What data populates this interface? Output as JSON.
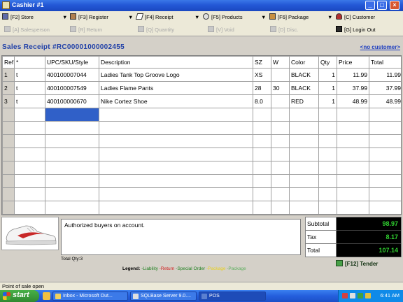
{
  "window": {
    "title": "Cashier #1",
    "controls": [
      "_",
      "□",
      "×"
    ]
  },
  "toolbar": {
    "row1": [
      {
        "label": "[F2] Store",
        "icon": "store-icon"
      },
      {
        "label": "[F3] Register",
        "icon": "register-icon"
      },
      {
        "label": "[F4] Receipt",
        "icon": "receipt-icon"
      },
      {
        "label": "[F5] Products",
        "icon": "products-icon"
      },
      {
        "label": "[F6] Package",
        "icon": "package-icon"
      },
      {
        "label": "[C] Customer",
        "icon": "customer-icon"
      }
    ],
    "row2": [
      {
        "label": "[A] Salesperson"
      },
      {
        "label": "[R] Return"
      },
      {
        "label": "[Q] Quantity"
      },
      {
        "label": "[V] Void"
      },
      {
        "label": "[D] Disc."
      },
      {
        "label": "[G] Login Out"
      }
    ]
  },
  "receipt": {
    "title": "Sales Receipt #RC00001000002455",
    "customer_link": "<no customer>"
  },
  "grid": {
    "headers": [
      "Ref",
      "*",
      "UPC/SKU/Style",
      "Description",
      "SZ",
      "W",
      "Color",
      "Qty",
      "Price",
      "Total"
    ],
    "rows": [
      {
        "ref": "1",
        "flag": "t",
        "upc": "400100007044",
        "desc": "Ladies Tank Top Groove Logo",
        "sz": "XS",
        "w": "",
        "color": "BLACK",
        "qty": "1",
        "price": "11.99",
        "total": "11.99"
      },
      {
        "ref": "2",
        "flag": "t",
        "upc": "400100007549",
        "desc": "Ladies Flame Pants",
        "sz": "28",
        "w": "30",
        "color": "BLACK",
        "qty": "1",
        "price": "37.99",
        "total": "37.99"
      },
      {
        "ref": "3",
        "flag": "t",
        "upc": "400100000670",
        "desc": "Nike Cortez Shoe",
        "sz": "8.0",
        "w": "",
        "color": "RED",
        "qty": "1",
        "price": "48.99",
        "total": "48.99"
      }
    ]
  },
  "notes": "Authorized buyers on account.",
  "total_qty": "Total Qty:3",
  "legend": {
    "label": "Legend:",
    "items": [
      {
        "text": "-Liability",
        "color": "#208020"
      },
      {
        "text": "-Return",
        "color": "#d02020"
      },
      {
        "text": "-Special Order",
        "color": "#208020"
      },
      {
        "text": "-Package",
        "color": "#e8d020"
      },
      {
        "text": "-Package",
        "color": "#60b060"
      }
    ]
  },
  "totals": {
    "subtotal_label": "Subtotal",
    "subtotal": "98.97",
    "tax_label": "Tax",
    "tax": "8.17",
    "total_label": "Total",
    "total": "107.14"
  },
  "tender": "[F12] Tender",
  "status": "Point of sale open",
  "taskbar": {
    "start": "start",
    "tasks": [
      "Inbox - Microsoft Out...",
      "SQLBase Server 9.0....",
      "POS"
    ],
    "clock": "6:41 AM"
  },
  "colors": {
    "accent": "#2040a8",
    "total_text": "#30d030",
    "selection": "#3060c8"
  }
}
